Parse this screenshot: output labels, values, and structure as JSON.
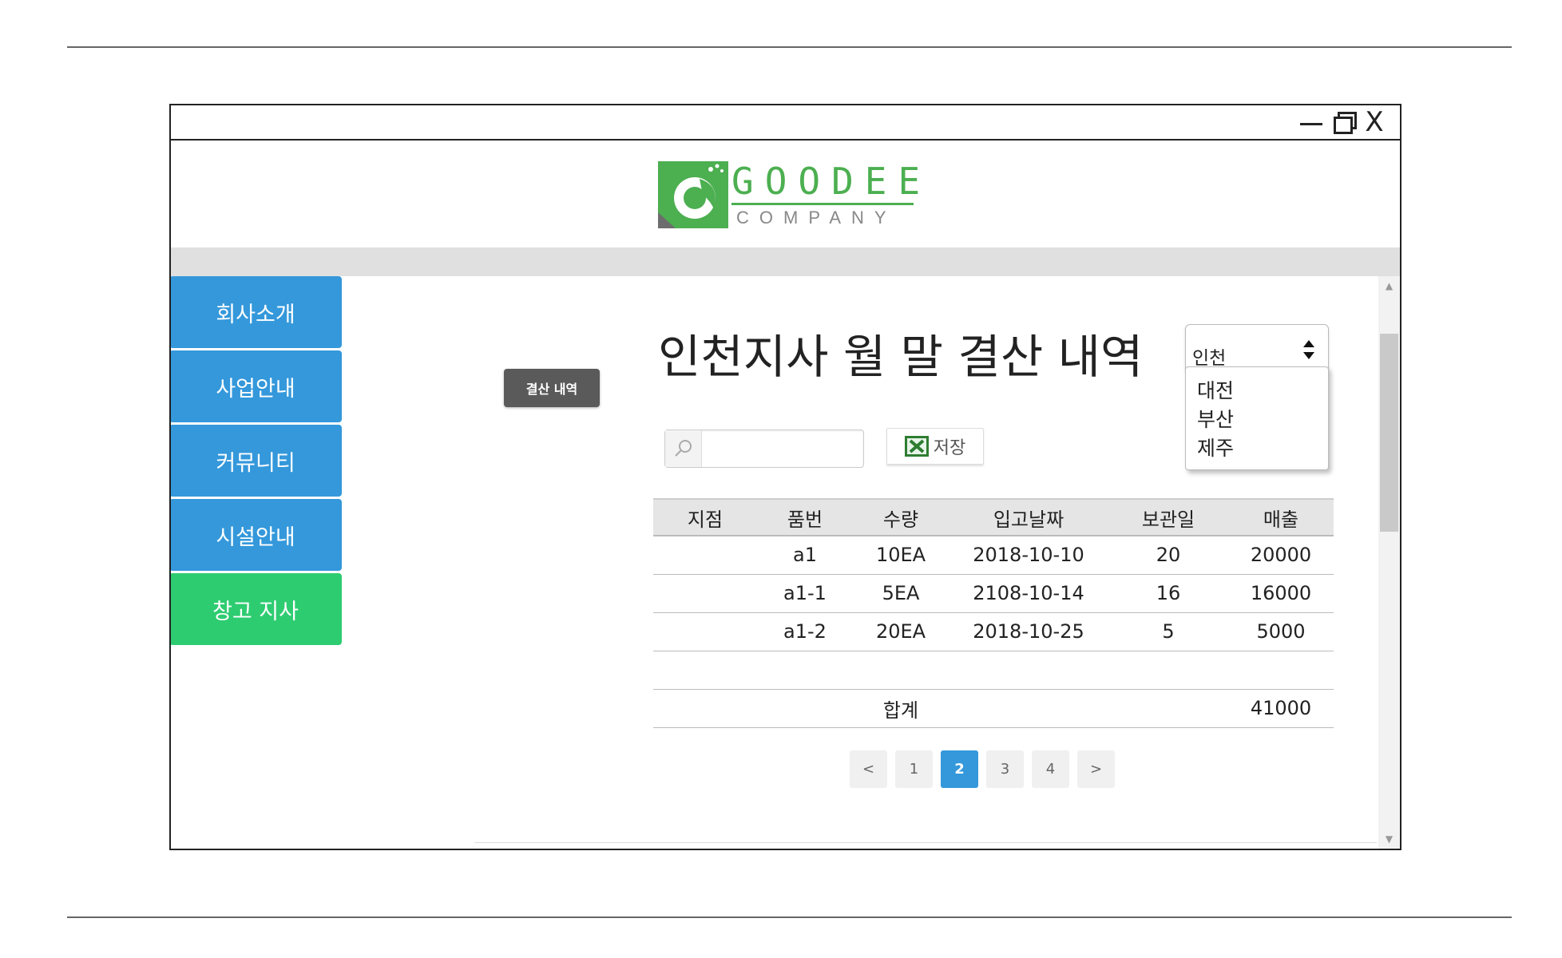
{
  "window": {
    "controls": {
      "minimize": "minimize",
      "maximize": "maximize",
      "close": "X"
    }
  },
  "logo": {
    "word": "GOODEE",
    "sub": "COMPANY",
    "color": "#4caf50"
  },
  "sidebar": {
    "items": [
      {
        "label": "회사소개",
        "active": false
      },
      {
        "label": "사업안내",
        "active": false
      },
      {
        "label": "커뮤니티",
        "active": false
      },
      {
        "label": "시설안내",
        "active": false
      },
      {
        "label": "창고 지사",
        "active": true
      }
    ],
    "color": "#3498db",
    "active_color": "#2ecc71"
  },
  "main": {
    "side_button": "결산 내역",
    "title": "인천지사 월 말 결산 내역",
    "branch_select": {
      "value": "인천",
      "options": [
        "대전",
        "부산",
        "제주"
      ]
    },
    "search": {
      "value": "",
      "placeholder": ""
    },
    "save_button": "저장",
    "table": {
      "headers": [
        "지점",
        "품번",
        "수량",
        "입고날짜",
        "보관일",
        "매출"
      ],
      "rows": [
        [
          "",
          "a1",
          "10EA",
          "2018-10-10",
          "20",
          "20000"
        ],
        [
          "",
          "a1-1",
          "5EA",
          "2108-10-14",
          "16",
          "16000"
        ],
        [
          "",
          "a1-2",
          "20EA",
          "2018-10-25",
          "5",
          "5000"
        ],
        [
          "",
          "",
          "",
          "",
          "",
          ""
        ]
      ],
      "total": {
        "label": "합계",
        "value": "41000"
      }
    },
    "pagination": {
      "prev": "<",
      "pages": [
        "1",
        "2",
        "3",
        "4"
      ],
      "current": "2",
      "next": ">"
    }
  }
}
